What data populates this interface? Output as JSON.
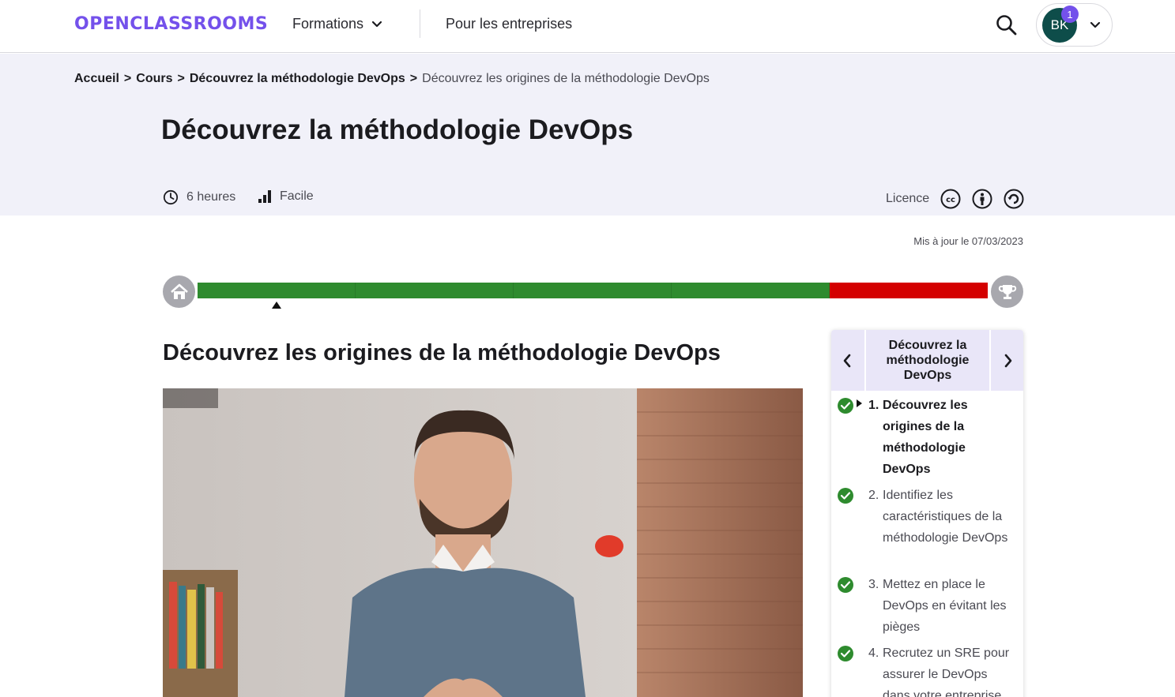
{
  "header": {
    "logo_text": "OPENCLASSROOMS",
    "nav_formations": "Formations",
    "nav_entreprises": "Pour les entreprises",
    "user_initials": "BK",
    "notification_count": "1"
  },
  "breadcrumb": {
    "items": [
      "Accueil",
      "Cours",
      "Découvrez la méthodologie DevOps"
    ],
    "separator": ">",
    "current": "Découvrez les origines de la méthodologie DevOps"
  },
  "course": {
    "title": "Découvrez la méthodologie DevOps",
    "duration": "6 heures",
    "level": "Facile",
    "licence_label": "Licence",
    "updated": "Mis à jour le 07/03/2023"
  },
  "progress": {
    "segments": [
      {
        "status": "complete",
        "color": "#2e8b2e"
      },
      {
        "status": "complete",
        "color": "#2e8b2e"
      },
      {
        "status": "complete",
        "color": "#2e8b2e"
      },
      {
        "status": "complete",
        "color": "#2e8b2e"
      },
      {
        "status": "incomplete",
        "color": "#d40000"
      }
    ],
    "current_segment": 1
  },
  "chapter": {
    "title": "Découvrez les origines de la méthodologie DevOps"
  },
  "toc": {
    "part_title": "Découvrez la méthodologie DevOps",
    "items": [
      {
        "num": "1.",
        "label": "Découvrez les origines de la méthodologie DevOps",
        "active": true,
        "done": true
      },
      {
        "num": "2.",
        "label": "Identifiez les caractéristiques de la méthodologie DevOps",
        "active": false,
        "done": true
      },
      {
        "num": "3.",
        "label": "Mettez en place le DevOps en évitant les pièges",
        "active": false,
        "done": true
      },
      {
        "num": "4.",
        "label": "Recrutez un SRE pour assurer le DevOps dans votre entreprise",
        "active": false,
        "done": true
      }
    ]
  },
  "colors": {
    "brand": "#7451eb",
    "check_green": "#2e8b2e",
    "progress_red": "#d40000",
    "avatar_bg": "#0e4d4a"
  }
}
